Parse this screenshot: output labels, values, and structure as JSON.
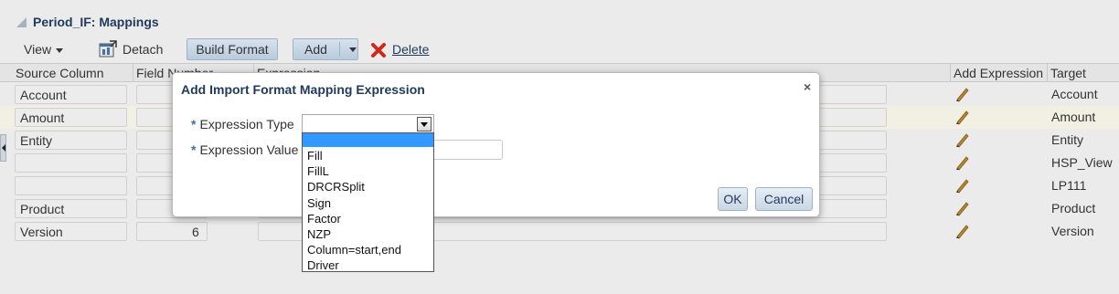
{
  "panel": {
    "title": "Period_IF: Mappings"
  },
  "toolbar": {
    "view_label": "View",
    "detach_label": "Detach",
    "build_format_label": "Build Format",
    "add_label": "Add",
    "delete_label": "Delete"
  },
  "grid": {
    "columns": {
      "source": "Source Column",
      "field": "Field Number",
      "expression": "Expression",
      "add_expression": "Add Expression",
      "target": "Target"
    },
    "rows": [
      {
        "source": "Account",
        "field": "",
        "target": "Account"
      },
      {
        "source": "Amount",
        "field": "",
        "target": "Amount"
      },
      {
        "source": "Entity",
        "field": "",
        "target": "Entity"
      },
      {
        "source": "",
        "field": "",
        "target": "HSP_View"
      },
      {
        "source": "",
        "field": "",
        "target": "LP111"
      },
      {
        "source": "Product",
        "field": "",
        "target": "Product"
      },
      {
        "source": "Version",
        "field": "6",
        "target": "Version"
      }
    ]
  },
  "dialog": {
    "title": "Add Import Format Mapping Expression",
    "close_glyph": "×",
    "required_mark": "*",
    "expression_type_label": "Expression Type",
    "expression_value_label": "Expression Value",
    "ok_label": "OK",
    "cancel_label": "Cancel"
  },
  "dropdown": {
    "options": [
      "",
      "Fill",
      "FillL",
      "DRCRSplit",
      "Sign",
      "Factor",
      "NZP",
      "Column=start,end",
      "Driver"
    ],
    "highlighted_index": 0
  },
  "colors": {
    "title_blue": "#1f3a5c",
    "alt_row": "#f2f0e3",
    "highlight": "#3399ff",
    "delete_red": "#cc2a1a",
    "pencil": "#b8862b"
  }
}
